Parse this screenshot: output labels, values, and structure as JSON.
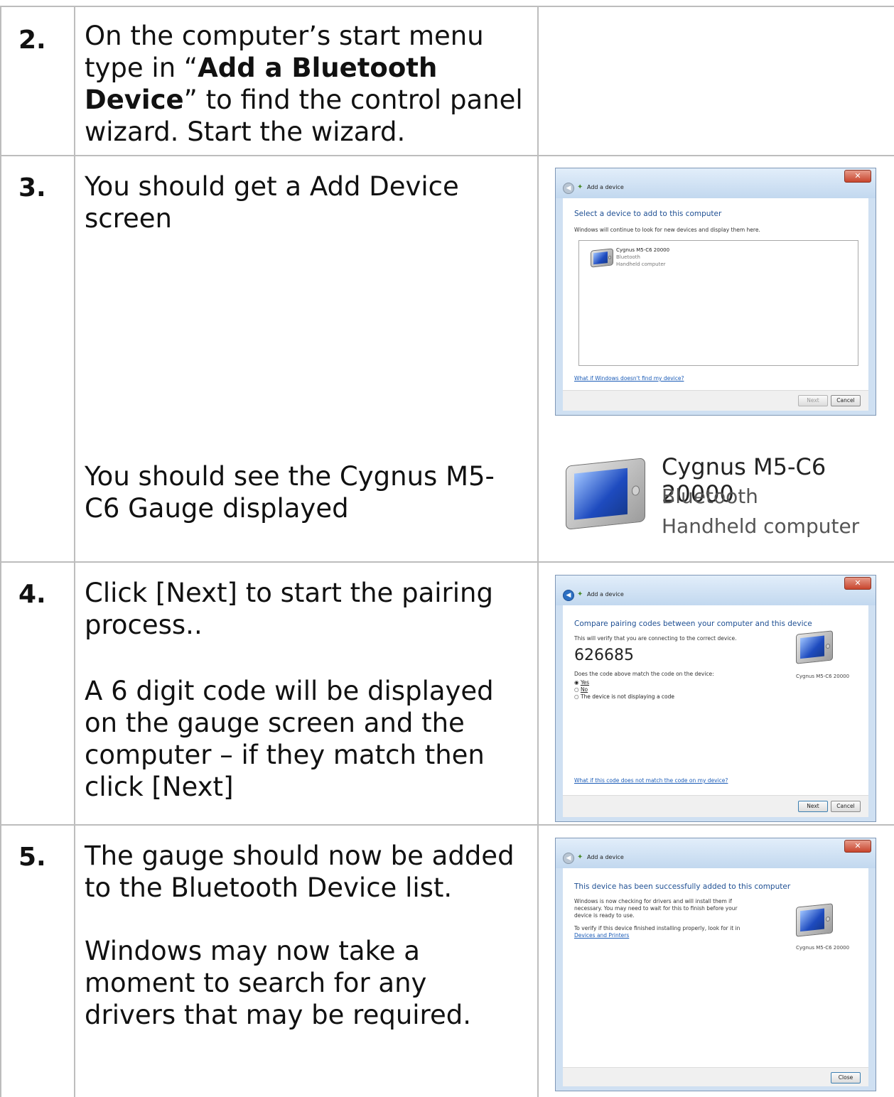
{
  "steps": [
    {
      "num": "2.",
      "text_pre": "On the computer’s start menu type in “",
      "text_bold": "Add a Bluetooth Device",
      "text_post": "” to find the control panel wizard. Start the wizard."
    },
    {
      "num": "3.",
      "text": "You should get a Add Device screen",
      "text2": "You should see the Cygnus M5-C6 Gauge displayed"
    },
    {
      "num": "4.",
      "text": "Click [Next] to start the pairing process..",
      "text2": "A 6 digit code will be displayed on the gauge screen and the computer – if they match then click [Next]"
    },
    {
      "num": "5.",
      "text": "The gauge should now be added to the Bluetooth Device list.",
      "text2": "Windows may now take a moment to search for any drivers that may be required."
    }
  ],
  "dialog_add": {
    "title": "Add a device",
    "heading": "Select a device to add to this computer",
    "subtitle": "Windows will continue to look for new devices and display them here.",
    "device_name": "Cygnus M5-C6 20000",
    "device_type": "Bluetooth",
    "device_kind": "Handheld computer",
    "help_link": "What if Windows doesn't find my device?",
    "next_label": "Next",
    "cancel_label": "Cancel"
  },
  "device_zoom": {
    "name": "Cygnus M5-C6 20000",
    "type": "Bluetooth",
    "kind": "Handheld computer"
  },
  "dialog_pair": {
    "title": "Add a device",
    "heading": "Compare pairing codes between your computer and this device",
    "subtitle": "This will verify that you are connecting to the correct device.",
    "code": "626685",
    "question": "Does the code above match the code on the device:",
    "options": [
      "Yes",
      "No",
      "The device is not displaying a code"
    ],
    "selected": "Yes",
    "device_caption": "Cygnus M5-C6 20000",
    "help_link": "What if this code does not match the code on my device?",
    "next_label": "Next",
    "cancel_label": "Cancel"
  },
  "dialog_done": {
    "title": "Add a device",
    "heading": "This device has been successfully added to this computer",
    "para1": "Windows is now checking for drivers and will install them if necessary. You may need to wait for this to finish before your device is ready to use.",
    "para2": "To verify if this device finished installing properly, look for it in",
    "link": "Devices and Printers",
    "device_caption": "Cygnus M5-C6 20000",
    "close_label": "Close"
  }
}
